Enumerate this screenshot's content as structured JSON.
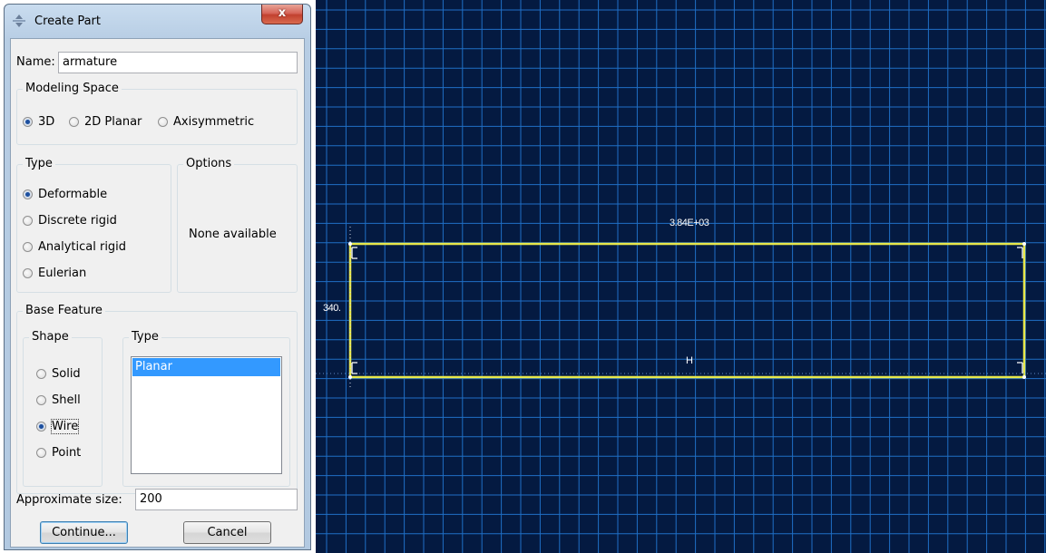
{
  "dialog": {
    "title": "Create Part",
    "close_glyph": "x",
    "name_label": "Name:",
    "name_value": "armature",
    "modeling_space": {
      "legend": "Modeling Space",
      "options": [
        "3D",
        "2D Planar",
        "Axisymmetric"
      ],
      "selected": "3D"
    },
    "type": {
      "legend": "Type",
      "options": [
        "Deformable",
        "Discrete rigid",
        "Analytical rigid",
        "Eulerian"
      ],
      "selected": "Deformable"
    },
    "options_group": {
      "legend": "Options",
      "text": "None available"
    },
    "base_feature": {
      "legend": "Base Feature",
      "shape_legend": "Shape",
      "shape_options": [
        "Solid",
        "Shell",
        "Wire",
        "Point"
      ],
      "shape_selected": "Wire",
      "type_legend": "Type",
      "type_items": [
        "Planar"
      ],
      "type_selected": "Planar"
    },
    "approx_size_label": "Approximate size:",
    "approx_size_value": "200",
    "continue_label": "Continue...",
    "cancel_label": "Cancel"
  },
  "viewport": {
    "background": "#041a41",
    "grid_color": "#1f6fc6",
    "sketch_color": "#e8e84a",
    "dimension_width": "3.84E+03",
    "dimension_height": "340.",
    "constraint_label": "H"
  }
}
